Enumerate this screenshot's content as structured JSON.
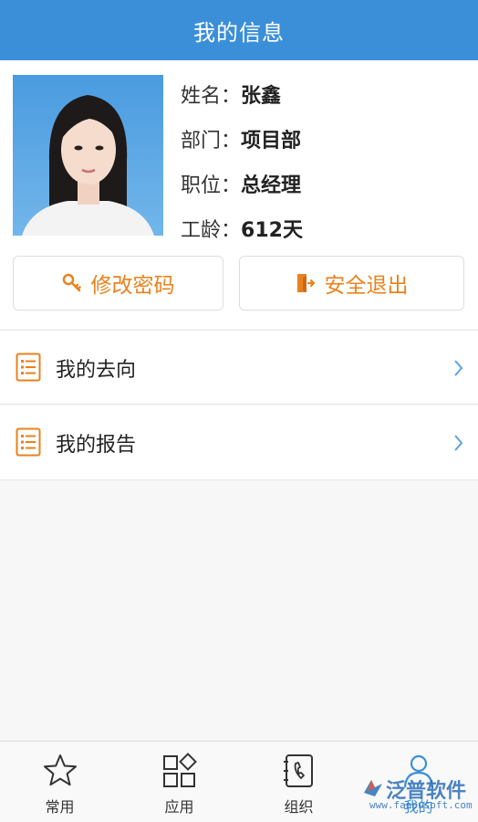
{
  "header": {
    "title": "我的信息"
  },
  "profile": {
    "name_label": "姓名：",
    "name_value": "张鑫",
    "dept_label": "部门：",
    "dept_value": "项目部",
    "position_label": "职位：",
    "position_value": "总经理",
    "tenure_label": "工龄：",
    "tenure_value": "612天"
  },
  "actions": {
    "change_password": "修改密码",
    "logout": "安全退出"
  },
  "menu": {
    "items": [
      {
        "label": "我的去向",
        "icon": "list-icon"
      },
      {
        "label": "我的报告",
        "icon": "list-icon"
      }
    ]
  },
  "tabbar": {
    "tabs": [
      {
        "label": "常用",
        "icon": "star-icon"
      },
      {
        "label": "应用",
        "icon": "apps-grid-icon"
      },
      {
        "label": "组织",
        "icon": "phone-book-icon"
      },
      {
        "label": "我的",
        "icon": "user-icon"
      }
    ]
  },
  "watermark": {
    "text": "泛普软件",
    "url": "www.fanpusoft.com"
  },
  "colors": {
    "header": "#3b8fd8",
    "accent": "#e8821e",
    "active_tab": "#3b8fd8"
  }
}
